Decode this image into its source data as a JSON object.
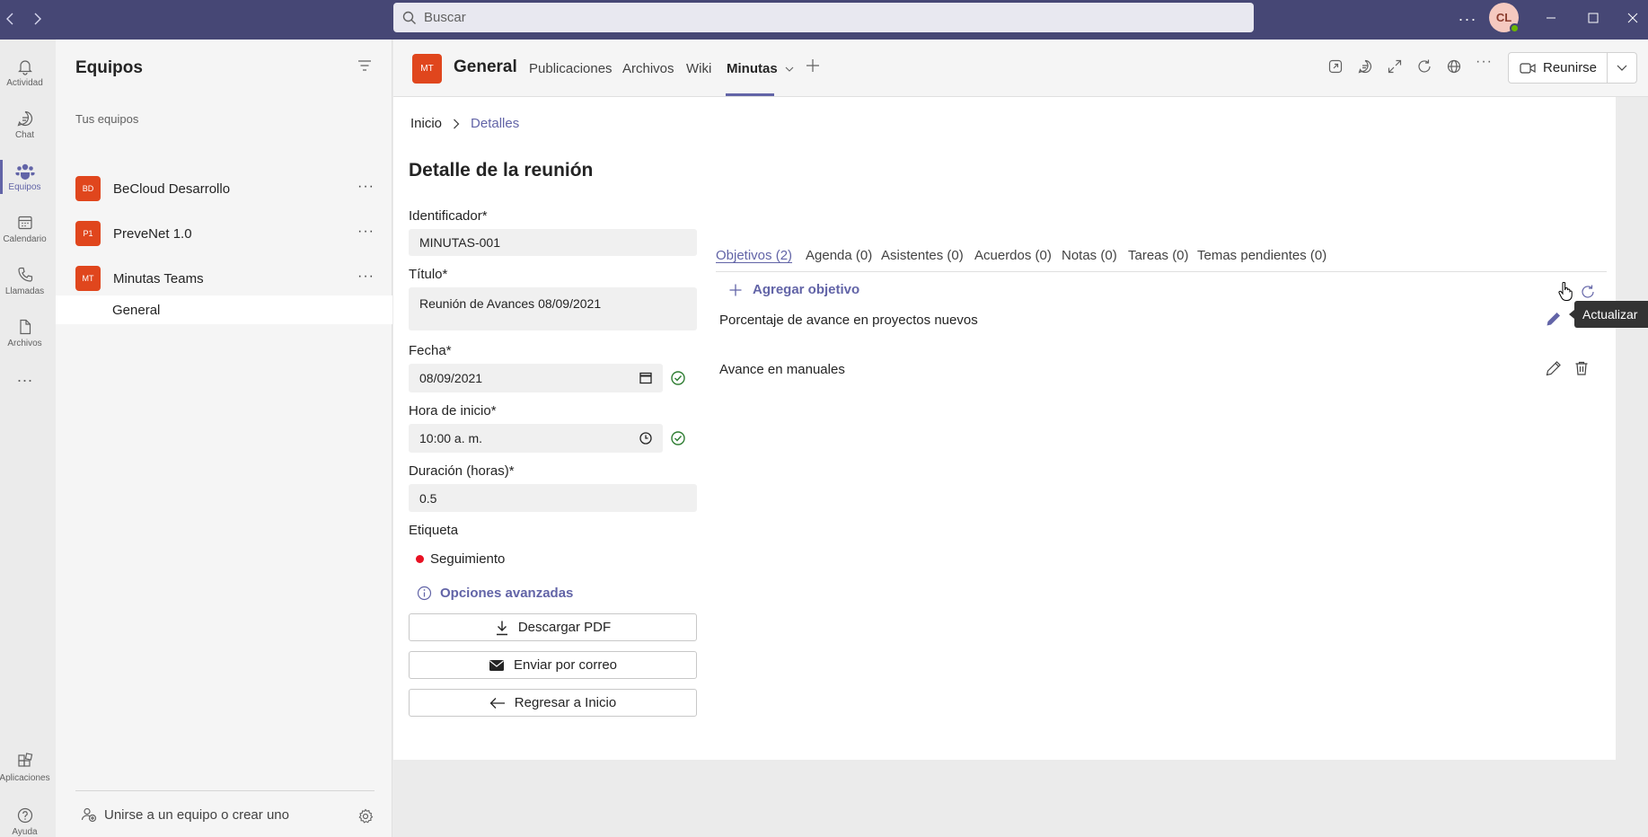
{
  "titlebar": {
    "search_placeholder": "Buscar",
    "user_initials": "CL"
  },
  "rail": {
    "items": [
      {
        "label": "Actividad",
        "icon": "bell-icon"
      },
      {
        "label": "Chat",
        "icon": "chat-icon"
      },
      {
        "label": "Equipos",
        "icon": "teams-icon"
      },
      {
        "label": "Calendario",
        "icon": "calendar-icon"
      },
      {
        "label": "Llamadas",
        "icon": "phone-icon"
      },
      {
        "label": "Archivos",
        "icon": "file-icon"
      }
    ],
    "bottom": [
      {
        "label": "Aplicaciones",
        "icon": "apps-icon"
      },
      {
        "label": "Ayuda",
        "icon": "help-icon"
      }
    ]
  },
  "panel": {
    "title": "Equipos",
    "section_label": "Tus equipos",
    "teams": [
      {
        "initials": "BD",
        "name": "BeCloud Desarrollo"
      },
      {
        "initials": "P1",
        "name": "PreveNet 1.0"
      },
      {
        "initials": "MT",
        "name": "Minutas Teams"
      }
    ],
    "channel": "General",
    "join_label": "Unirse a un equipo o crear uno"
  },
  "channel_header": {
    "initials": "MT",
    "name": "General",
    "tabs": [
      "Publicaciones",
      "Archivos",
      "Wiki",
      "Minutas"
    ],
    "active_tab": "Minutas",
    "meet_label": "Reunirse"
  },
  "breadcrumb": {
    "home": "Inicio",
    "current": "Detalles"
  },
  "page_title": "Detalle de la reunión",
  "form": {
    "id_label": "Identificador*",
    "id_value": "MINUTAS-001",
    "title_label": "Título*",
    "title_value": "Reunión  de Avances 08/09/2021",
    "date_label": "Fecha*",
    "date_value": "08/09/2021",
    "time_label": "Hora de inicio*",
    "time_value": "10:00  a. m.",
    "duration_label": "Duración (horas)*",
    "duration_value": "0.5",
    "tag_label": "Etiqueta",
    "tag_value": "Seguimiento",
    "tag_color": "#e81123",
    "advanced_label": "Opciones avanzadas"
  },
  "actions": {
    "pdf": "Descargar PDF",
    "email": "Enviar por correo",
    "back": "Regresar a Inicio"
  },
  "subtabs": [
    "Objetivos (2)",
    "Agenda (0)",
    "Asistentes (0)",
    "Acuerdos (0)",
    "Notas (0)",
    "Tareas (0)",
    "Temas pendientes (0)"
  ],
  "objectives": {
    "add_label": "Agregar objetivo",
    "items": [
      "Porcentaje de avance en proyectos nuevos",
      "Avance en manuales"
    ]
  },
  "tooltip": "Actualizar",
  "colors": {
    "brand": "#6264a7",
    "titlebar": "#464775",
    "team_avatar": "#e0461d"
  }
}
